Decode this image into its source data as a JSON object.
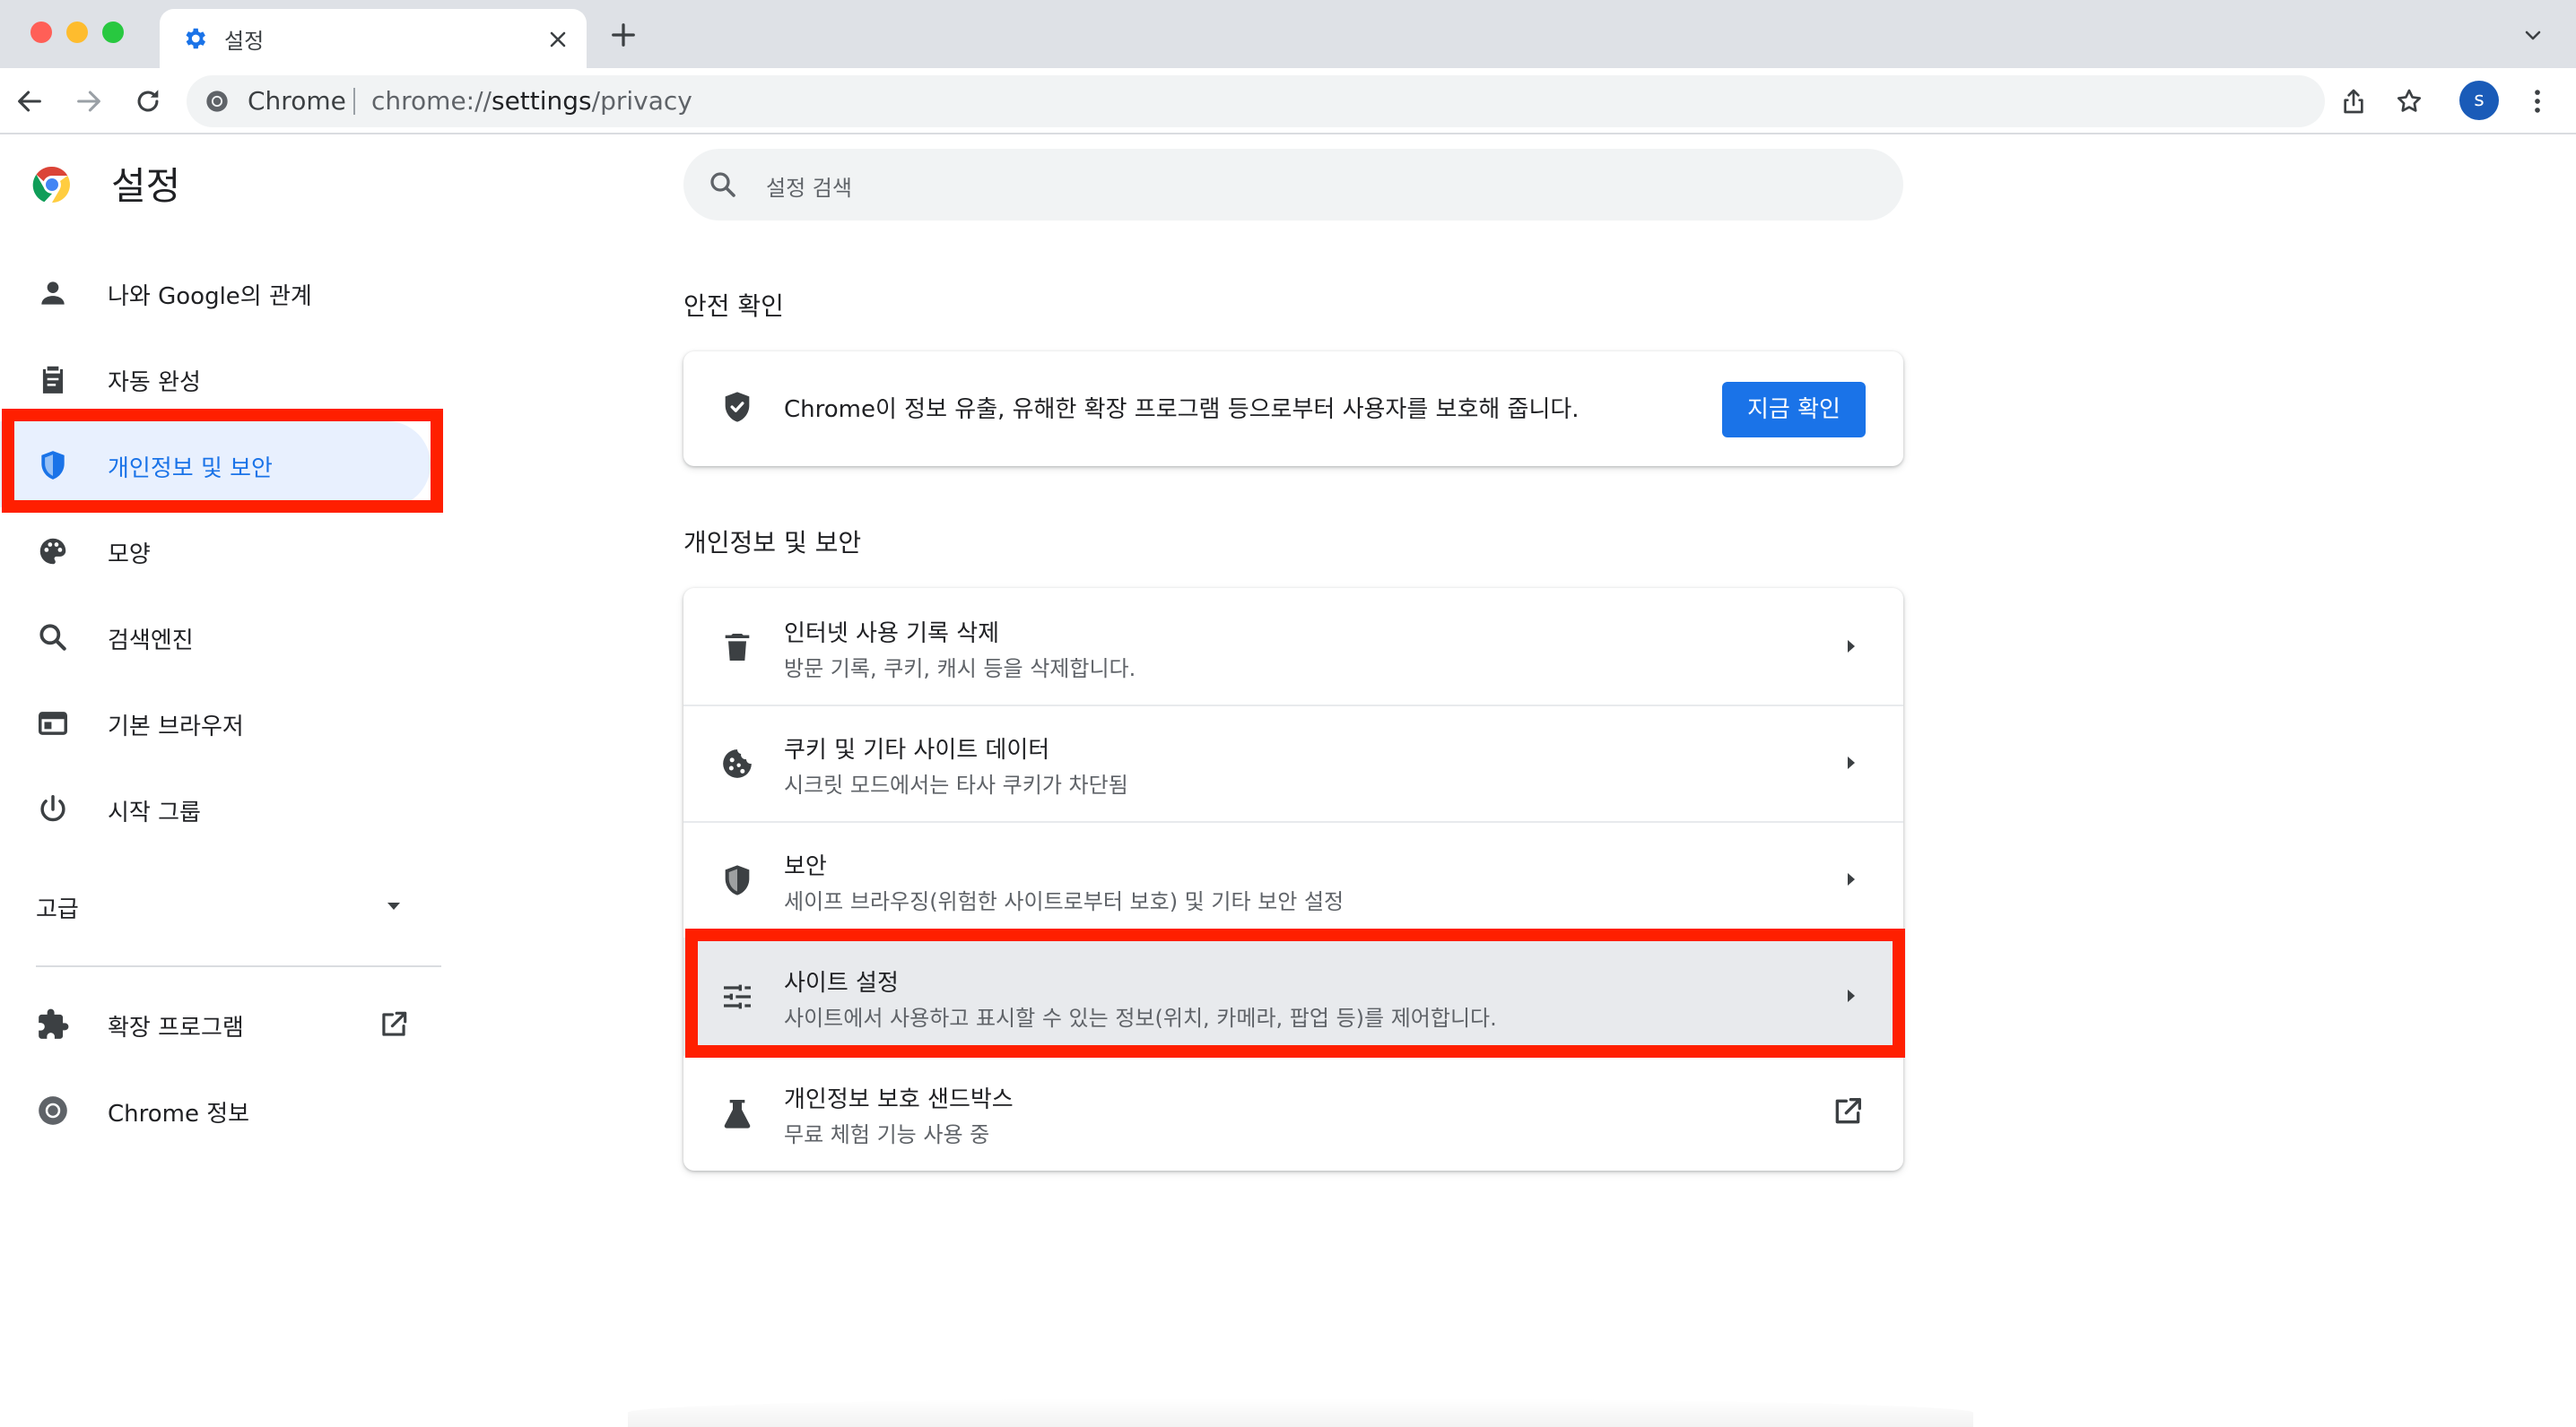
{
  "window": {
    "tab": {
      "title": "설정",
      "favicon": "gear-icon"
    },
    "new_tab_icon": "plus-icon",
    "tab_search_icon": "chevron-down-icon"
  },
  "toolbar": {
    "back_icon": "arrow-left-icon",
    "forward_icon": "arrow-right-icon",
    "reload_icon": "reload-icon",
    "omnibox": {
      "site_label": "Chrome",
      "url_prefix": "chrome://",
      "url_host": "settings",
      "url_path": "/privacy"
    },
    "avatar_initial": "s"
  },
  "header": {
    "title": "설정",
    "search_placeholder": "설정 검색"
  },
  "sidebar": {
    "items": [
      {
        "label": "나와 Google의 관계",
        "icon": "person-icon"
      },
      {
        "label": "자동 완성",
        "icon": "clipboard-icon"
      },
      {
        "label": "개인정보 및 보안",
        "icon": "shield-icon",
        "active": true
      },
      {
        "label": "모양",
        "icon": "palette-icon"
      },
      {
        "label": "검색엔진",
        "icon": "search-icon"
      },
      {
        "label": "기본 브라우저",
        "icon": "browser-window-icon"
      },
      {
        "label": "시작 그룹",
        "icon": "power-icon"
      }
    ],
    "advanced_label": "고급",
    "extensions_label": "확장 프로그램",
    "about_label": "Chrome 정보"
  },
  "safety_check": {
    "section_title": "안전 확인",
    "description": "Chrome이 정보 유출, 유해한 확장 프로그램 등으로부터 사용자를 보호해 줍니다.",
    "button_label": "지금 확인"
  },
  "privacy": {
    "section_title": "개인정보 및 보안",
    "rows": [
      {
        "title": "인터넷 사용 기록 삭제",
        "subtitle": "방문 기록, 쿠키, 캐시 등을 삭제합니다.",
        "icon": "trash-icon"
      },
      {
        "title": "쿠키 및 기타 사이트 데이터",
        "subtitle": "시크릿 모드에서는 타사 쿠키가 차단됨",
        "icon": "cookie-icon"
      },
      {
        "title": "보안",
        "subtitle": "세이프 브라우징(위험한 사이트로부터 보호) 및 기타 보안 설정",
        "icon": "shield-icon"
      },
      {
        "title": "사이트 설정",
        "subtitle": "사이트에서 사용하고 표시할 수 있는 정보(위치, 카메라, 팝업 등)를 제어합니다.",
        "icon": "tune-icon",
        "highlighted": true
      },
      {
        "title": "개인정보 보호 샌드박스",
        "subtitle": "무료 체험 기능 사용 중",
        "icon": "flask-icon"
      }
    ]
  },
  "colors": {
    "accent": "#1a73e8",
    "highlight_outline": "#ff1f00",
    "active_nav_bg": "#e8f0fe"
  }
}
